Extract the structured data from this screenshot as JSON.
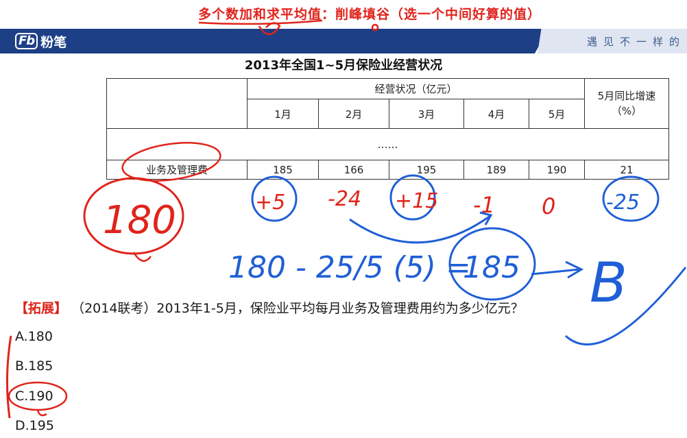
{
  "top_note": "多个数加和求平均值：削峰填谷（选一个中间好算的值）",
  "header": {
    "logo_mark": "Fb",
    "logo_text": "粉笔",
    "slogan": "遇见不一样的"
  },
  "table": {
    "title": "2013年全国1~5月保险业经营状况",
    "group_header": "经营状况（亿元）",
    "growth_header": "5月同比增速（%）",
    "months": [
      "1月",
      "2月",
      "3月",
      "4月",
      "5月"
    ],
    "ellipsis": "……",
    "row_label": "业务及管理费",
    "row_values": [
      "185",
      "166",
      "195",
      "189",
      "190",
      "21"
    ]
  },
  "annotations": {
    "red_base": "180",
    "deviations": [
      "+5",
      "-24",
      "+15",
      "-1",
      "0",
      "-25"
    ],
    "formula": "180 - 25/5 (5) =",
    "result": "185",
    "answer_letter": "B"
  },
  "question": {
    "tag": "【拓展】",
    "text": "（2014联考）2013年1-5月，保险业平均每月业务及管理费用约为多少亿元？",
    "options": [
      "A.180",
      "B.185",
      "C.190",
      "D.195"
    ]
  },
  "colors": {
    "header_blue": "#1d3f86",
    "header_light": "#dfe6f1",
    "annotation_red": "#e0231b",
    "annotation_blue": "#1f5fd6"
  }
}
